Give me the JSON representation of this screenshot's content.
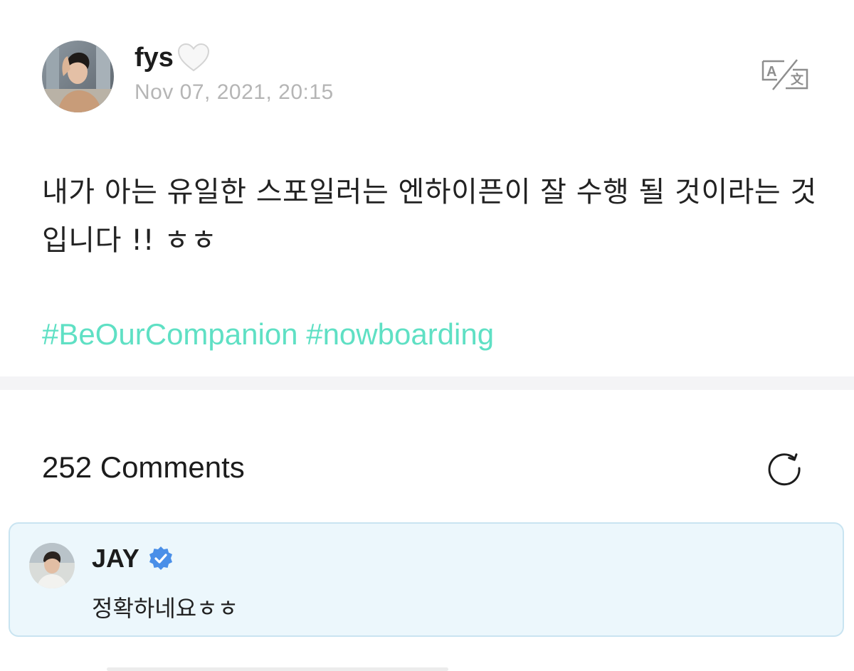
{
  "post": {
    "author": "fys",
    "author_emoji_icon": "white-heart-icon",
    "date": "Nov 07, 2021, 20:15",
    "text": "내가 아는 유일한 스포일러는 엔하이픈이 잘 수행 될 것이라는 것입니다 !! ㅎㅎ",
    "hashtags": [
      "#BeOurCompanion",
      "#nowboarding"
    ],
    "translate_icon": "translate-icon"
  },
  "comments": {
    "count_label": "252 Comments",
    "refresh_icon": "refresh-icon",
    "items": [
      {
        "author": "JAY",
        "verified_icon": "verified-badge-icon",
        "text": "정확하네요ㅎㅎ",
        "highlight_color": "#ecf7fc"
      }
    ]
  },
  "colors": {
    "hashtag": "#5fe0c4",
    "date": "#b5b5b5",
    "verified": "#4a8fe8",
    "comment_background": "#ecf7fc",
    "comment_border": "#c9e4f1"
  }
}
